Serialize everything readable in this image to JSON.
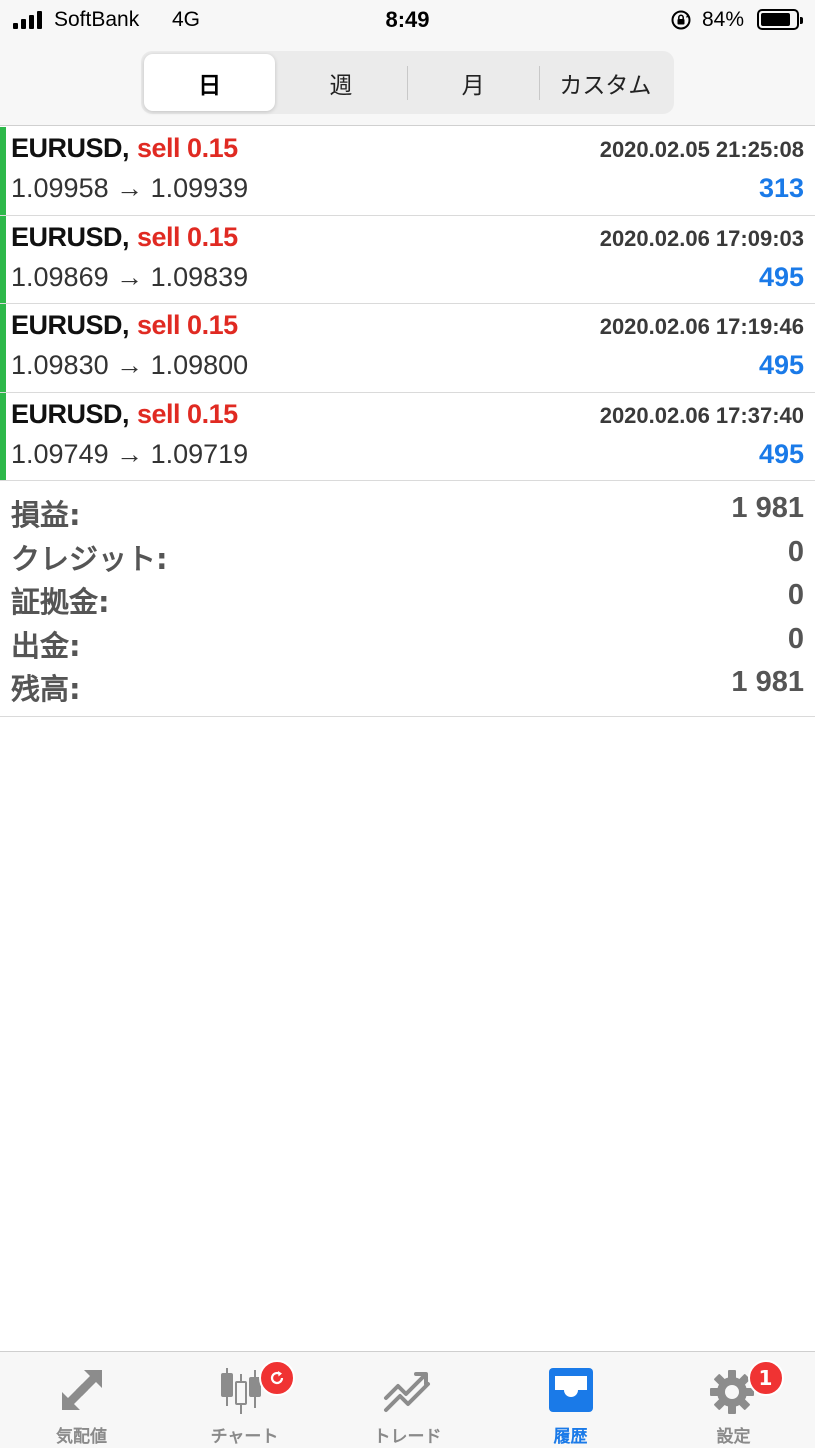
{
  "status_bar": {
    "carrier": "SoftBank",
    "network": "4G",
    "time": "8:49",
    "battery_percent": "84%",
    "battery_level": 0.84
  },
  "segments": [
    {
      "label": "日",
      "active": true
    },
    {
      "label": "週",
      "active": false
    },
    {
      "label": "月",
      "active": false
    },
    {
      "label": "カスタム",
      "active": false
    }
  ],
  "deals": [
    {
      "symbol": "EURUSD,",
      "side": "sell 0.15",
      "time": "2020.02.05 21:25:08",
      "prices": "1.09958 → 1.09939",
      "profit": "313"
    },
    {
      "symbol": "EURUSD,",
      "side": "sell 0.15",
      "time": "2020.02.06 17:09:03",
      "prices": "1.09869 → 1.09839",
      "profit": "495"
    },
    {
      "symbol": "EURUSD,",
      "side": "sell 0.15",
      "time": "2020.02.06 17:19:46",
      "prices": "1.09830 → 1.09800",
      "profit": "495"
    },
    {
      "symbol": "EURUSD,",
      "side": "sell 0.15",
      "time": "2020.02.06 17:37:40",
      "prices": "1.09749 → 1.09719",
      "profit": "495"
    }
  ],
  "summary": [
    {
      "label": "損益:",
      "value": "1 981"
    },
    {
      "label": "クレジット:",
      "value": "0"
    },
    {
      "label": "証拠金:",
      "value": "0"
    },
    {
      "label": "出金:",
      "value": "0"
    },
    {
      "label": "残高:",
      "value": "1 981"
    }
  ],
  "tabs": [
    {
      "label": "気配値",
      "icon": "quotes-arrows-icon",
      "active": false
    },
    {
      "label": "チャート",
      "icon": "candlestick-chart-icon",
      "active": false,
      "badge_icon": "refresh-icon"
    },
    {
      "label": "トレード",
      "icon": "trade-trend-icon",
      "active": false
    },
    {
      "label": "履歴",
      "icon": "history-inbox-icon",
      "active": true
    },
    {
      "label": "設定",
      "icon": "gear-icon",
      "active": false,
      "badge": "1"
    }
  ],
  "colors": {
    "accent_green": "#2db84a",
    "sell_red": "#e02a22",
    "profit_blue": "#1a7ae8",
    "badge_red": "#f03333"
  }
}
